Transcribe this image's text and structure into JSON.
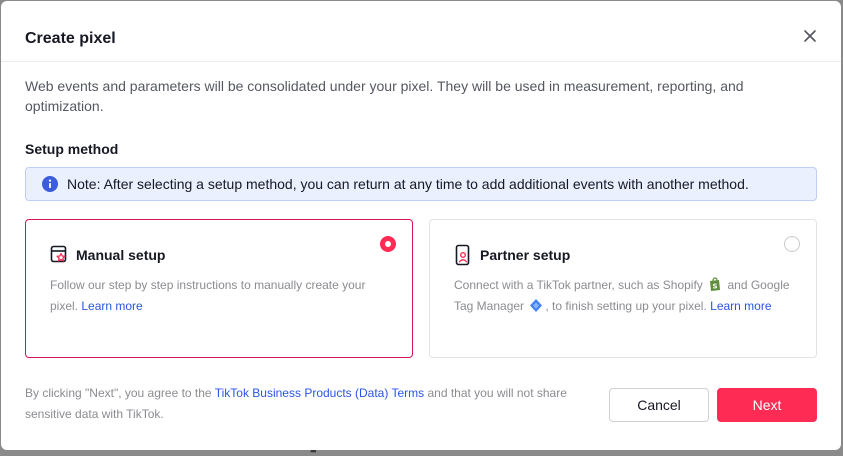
{
  "dialog": {
    "title": "Create pixel",
    "description": "Web events and parameters will be consolidated under your pixel. They will be used in measurement, reporting, and optimization.",
    "setup_method_label": "Setup method",
    "note": "Note: After selecting a setup method, you can return at any time to add additional events with another method."
  },
  "options": {
    "manual": {
      "title": "Manual setup",
      "desc": "Follow our step by step instructions to manually create your pixel.",
      "link": "Learn more",
      "selected": true
    },
    "partner": {
      "title": "Partner setup",
      "desc_part1": "Connect with a TikTok partner, such as Shopify",
      "desc_part2": "and Google Tag Manager",
      "desc_part3": ", to finish setting up your pixel.",
      "link": "Learn more",
      "selected": false
    }
  },
  "footer": {
    "text_before": "By clicking \"Next\", you agree to the ",
    "terms_link": "TikTok Business Products (Data) Terms",
    "text_after": " and that you will not share sensitive data with TikTok.",
    "cancel_label": "Cancel",
    "next_label": "Next"
  },
  "colors": {
    "accent": "#fe2c55",
    "selected_border": "#d4145a",
    "link": "#2a55e5",
    "note_bg": "#eaf0fd"
  },
  "icons": {
    "close": "close-icon",
    "info": "info-icon",
    "manual": "browser-star-icon",
    "partner": "phone-person-icon",
    "shopify": "shopify-logo-icon",
    "gtm": "google-tag-manager-icon"
  }
}
